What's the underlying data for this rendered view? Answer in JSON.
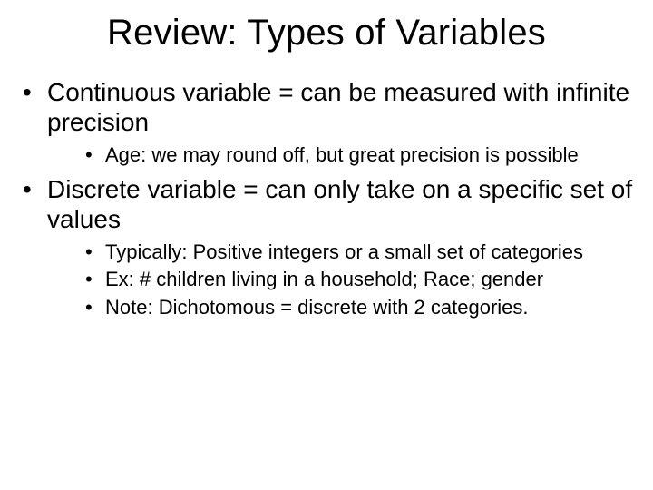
{
  "title": "Review:  Types of Variables",
  "bullets": [
    {
      "text": "Continuous variable = can be measured with infinite precision",
      "sub": [
        "Age:  we may round off, but great precision is possible"
      ]
    },
    {
      "text": "Discrete variable = can only take on a specific set of values",
      "sub": [
        "Typically:  Positive integers or a small set of categories",
        "Ex:  # children living in a household; Race; gender",
        "Note:  Dichotomous = discrete with 2 categories."
      ]
    }
  ]
}
